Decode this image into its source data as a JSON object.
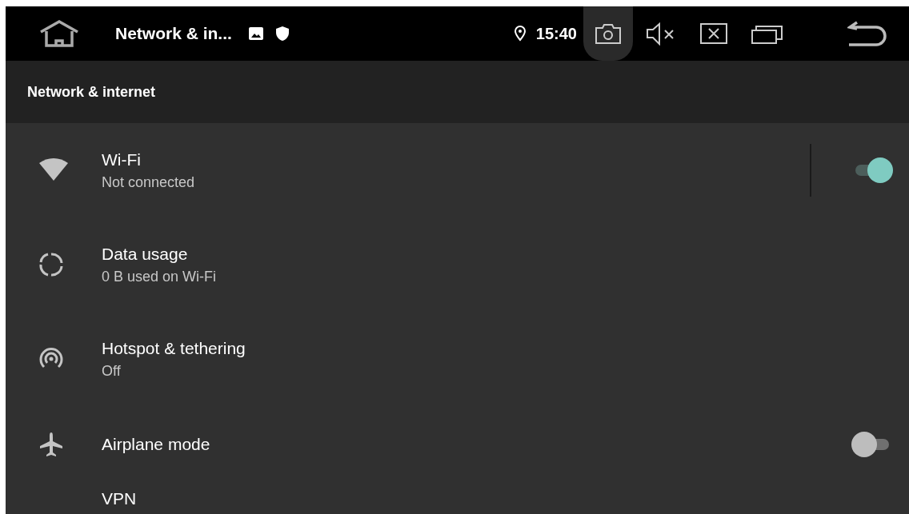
{
  "status_bar": {
    "title": "Network & in...",
    "time": "15:40"
  },
  "header": {
    "title": "Network & internet"
  },
  "items": [
    {
      "kind": "switch",
      "title": "Wi-Fi",
      "summary": "Not connected",
      "checked": true
    },
    {
      "kind": "plain",
      "title": "Data usage",
      "summary": "0 B used on Wi-Fi"
    },
    {
      "kind": "plain",
      "title": "Hotspot & tethering",
      "summary": "Off"
    },
    {
      "kind": "toggle",
      "title": "Airplane mode",
      "checked": false
    },
    {
      "kind": "plain",
      "title": "VPN"
    }
  ]
}
